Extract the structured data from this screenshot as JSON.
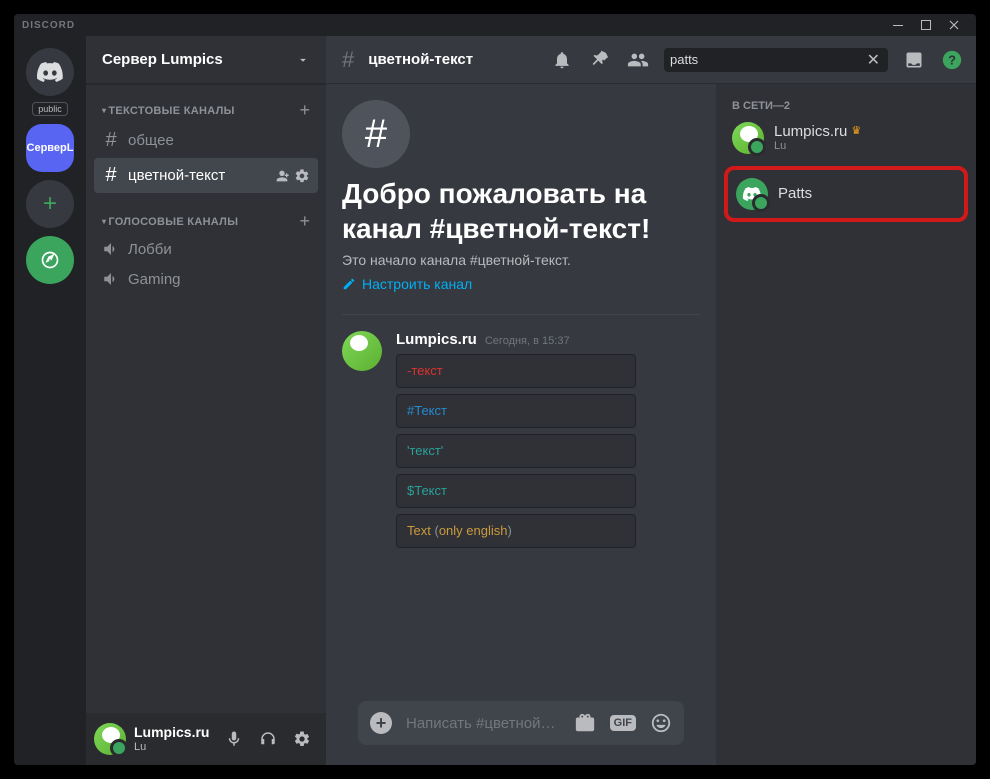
{
  "titlebar": {
    "brand": "DISCORD"
  },
  "server": {
    "name": "Сервер Lumpics",
    "textCategory": "ТЕКСТОВЫЕ КАНАЛЫ",
    "voiceCategory": "ГОЛОСОВЫЕ КАНАЛЫ",
    "textChannels": {
      "0": {
        "name": "общее"
      },
      "1": {
        "name": "цветной-текст"
      }
    },
    "voiceChannels": {
      "0": {
        "name": "Лобби"
      },
      "1": {
        "name": "Gaming"
      }
    }
  },
  "guilds": {
    "publicPill": "public",
    "serverAbbr": "СерверL"
  },
  "user": {
    "name": "Lumpics.ru",
    "sub": "Lu"
  },
  "topbar": {
    "channel": "цветной-текст",
    "searchValue": "patts"
  },
  "welcome": {
    "title": "Добро пожаловать на канал #цветной-текст!",
    "sub": "Это начало канала #цветной-текст.",
    "setup": "Настроить канал"
  },
  "message": {
    "author": "Lumpics.ru",
    "time": "Сегодня, в 15:37",
    "lines": {
      "0": "-текст",
      "1": "#Текст",
      "2": "'текст'",
      "3": "$Текст",
      "4a": "Text ",
      "4b": "(",
      "4c": "only english",
      "4d": ")"
    }
  },
  "input": {
    "placeholder": "Написать #цветной-т..."
  },
  "members": {
    "header": "В СЕТИ—2",
    "0": {
      "name": "Lumpics.ru",
      "sub": "Lu"
    },
    "1": {
      "name": "Patts"
    }
  }
}
